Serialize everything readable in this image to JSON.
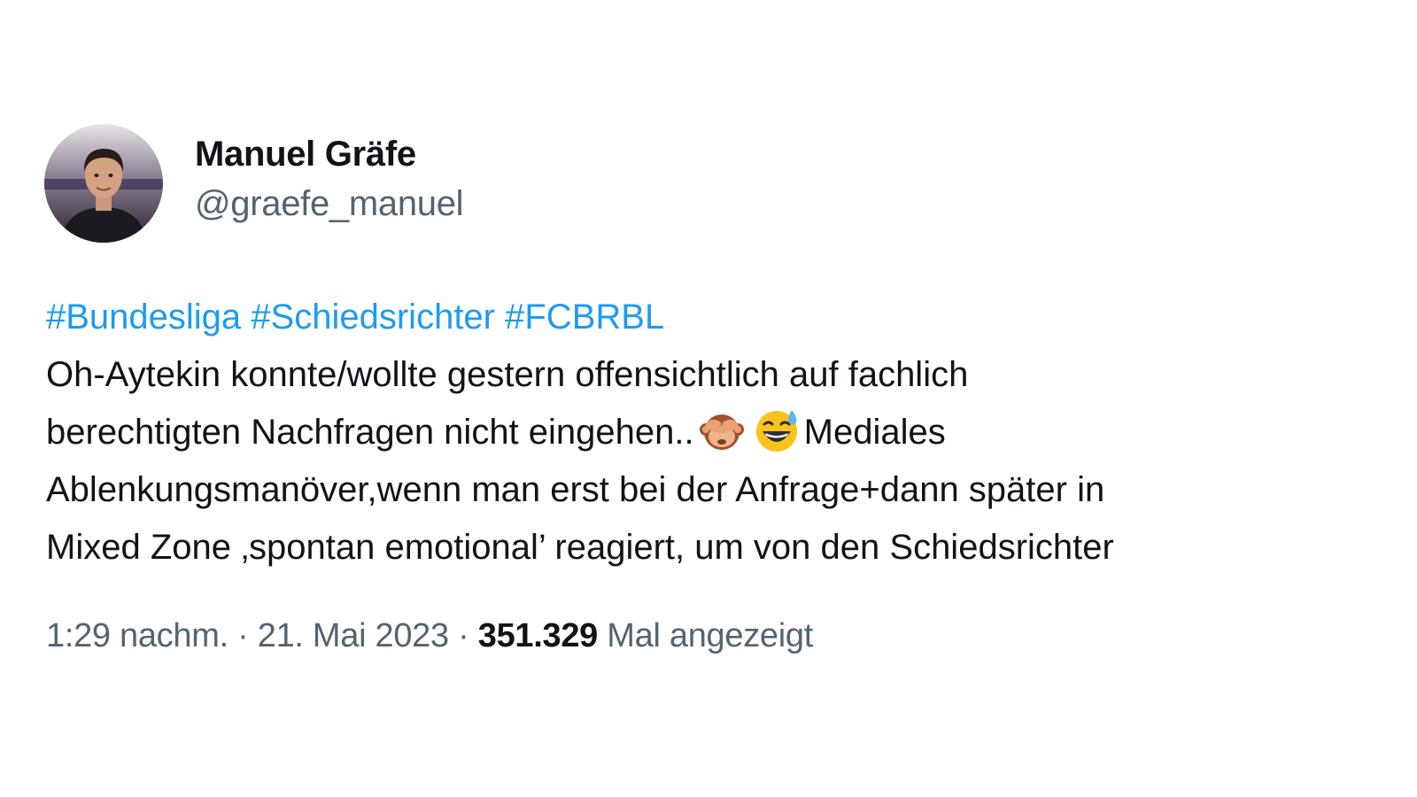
{
  "author": {
    "name": "Manuel Gräfe",
    "handle": "@graefe_manuel",
    "avatar_icon": "profile-photo"
  },
  "tweet": {
    "hashtags": [
      "#Bundesliga",
      "#Schiedsrichter",
      "#FCBRBL"
    ],
    "line1": "Oh-Aytekin konnte/wollte gestern offensichtlich auf fachlich",
    "line2_before_emoji": "berechtigten Nachfragen nicht eingehen..",
    "emojis": [
      "see-no-evil-monkey-emoji",
      "grinning-face-with-sweat-emoji"
    ],
    "line2_after_emoji": "Mediales",
    "line3": "Ablenkungsmanöver,wenn man erst bei der Anfrage+dann später in",
    "line4": "Mixed Zone ‚spontan emotional’ reagiert, um von den Schiedsrichter"
  },
  "meta": {
    "time": "1:29 nachm.",
    "separator": "·",
    "date": "21. Mai 2023",
    "views_count": "351.329",
    "views_label": "Mal angezeigt"
  },
  "colors": {
    "hashtag": "#1d9bf0",
    "text": "#0f1419",
    "secondary": "#536471",
    "background": "#ffffff"
  }
}
